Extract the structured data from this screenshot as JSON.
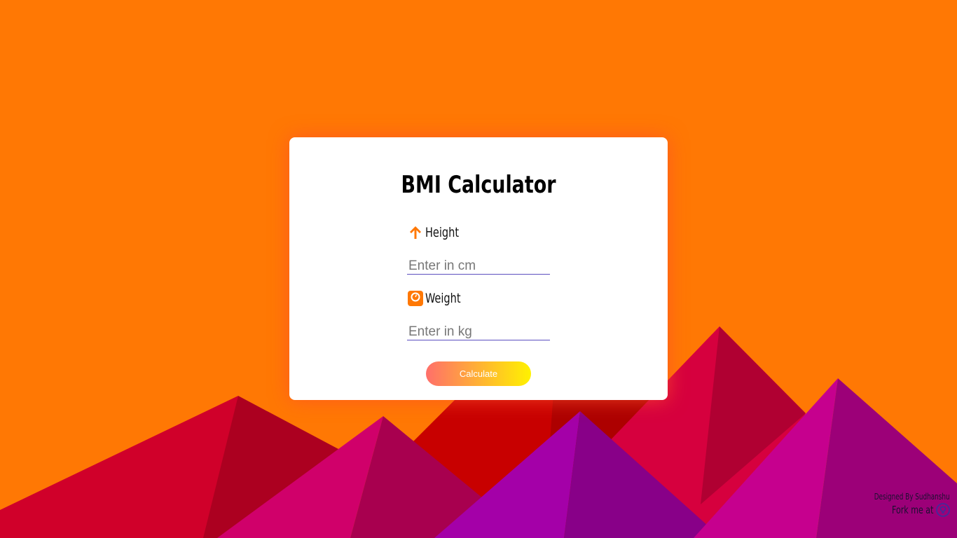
{
  "colors": {
    "background": "#ff7804",
    "accent": "#ff7804",
    "card": "#ffffff",
    "input_underline": "#5b4ec0",
    "button_gradient_start": "#ff6f6a",
    "button_gradient_end": "#fff200"
  },
  "card": {
    "title": "BMI Calculator",
    "height": {
      "icon": "arrow-up-icon",
      "label": "Height",
      "placeholder": "Enter in cm",
      "value": ""
    },
    "weight": {
      "icon": "weighing-scale-icon",
      "label": "Weight",
      "placeholder": "Enter in kg",
      "value": ""
    },
    "button_label": "Calculate"
  },
  "footer": {
    "designed_by": "Designed By Sudhanshu",
    "fork_text": "Fork me at",
    "fork_icon": "github-icon"
  }
}
